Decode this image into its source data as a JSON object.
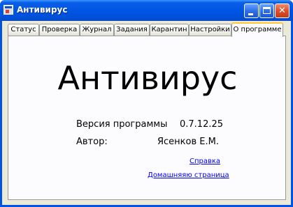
{
  "window": {
    "title": "Антивирус"
  },
  "tabs": [
    {
      "label": "Статус"
    },
    {
      "label": "Проверка"
    },
    {
      "label": "Журнал"
    },
    {
      "label": "Задания"
    },
    {
      "label": "Карантин"
    },
    {
      "label": "Настройки"
    },
    {
      "label": "О программе",
      "active": true
    }
  ],
  "about": {
    "app_name": "Антивирус",
    "version_label": "Версия программы",
    "version_value": "0.7.12.25",
    "author_label": "Автор:",
    "author_value": "Ясенков Е.М.",
    "help_link": "Справка",
    "homepage_link": "Домашняяю страница"
  }
}
